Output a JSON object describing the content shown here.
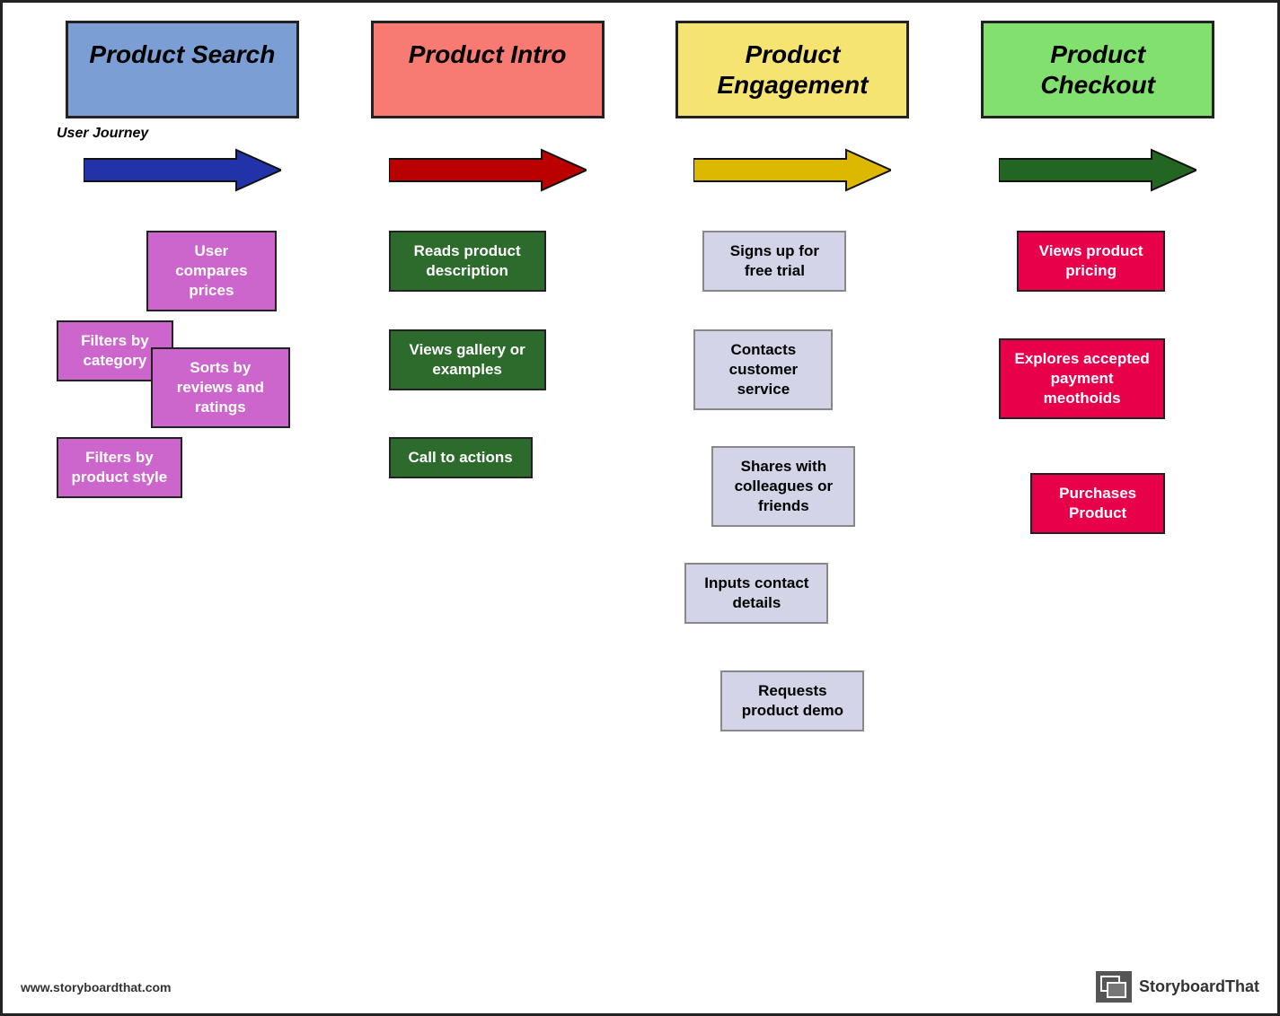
{
  "headers": [
    {
      "id": "product-search",
      "label": "Product Search",
      "color": "blue"
    },
    {
      "id": "product-intro",
      "label": "Product Intro",
      "color": "red"
    },
    {
      "id": "product-engagement",
      "label": "Product\nEngagement",
      "color": "yellow"
    },
    {
      "id": "product-checkout",
      "label": "Product\nCheckout",
      "color": "green"
    }
  ],
  "arrow_label": "User Journey",
  "arrows": [
    {
      "id": "arrow-blue",
      "color": "#2233aa"
    },
    {
      "id": "arrow-red",
      "color": "#bb0000"
    },
    {
      "id": "arrow-yellow",
      "color": "#ddb800"
    },
    {
      "id": "arrow-green",
      "color": "#226622"
    }
  ],
  "col1": {
    "item_user_compares": "User compares prices",
    "item_filters_cat": "Filters by category",
    "item_sorts": "Sorts by reviews and ratings",
    "item_filters_style": "Filters by product style"
  },
  "col2": {
    "item_reads": "Reads product description",
    "item_views_gallery": "Views gallery or examples",
    "item_cta": "Call to actions"
  },
  "col3": {
    "item_signs_up": "Signs up for free trial",
    "item_contacts": "Contacts customer service",
    "item_shares": "Shares with colleagues or friends",
    "item_inputs": "Inputs contact details",
    "item_requests": "Requests product demo"
  },
  "col4": {
    "item_views_pricing": "Views product pricing",
    "item_explores": "Explores accepted payment meothoids",
    "item_purchases": "Purchases Product"
  },
  "footer": {
    "url": "www.storyboardthat.com",
    "logo_text": "StoryboardThat"
  }
}
